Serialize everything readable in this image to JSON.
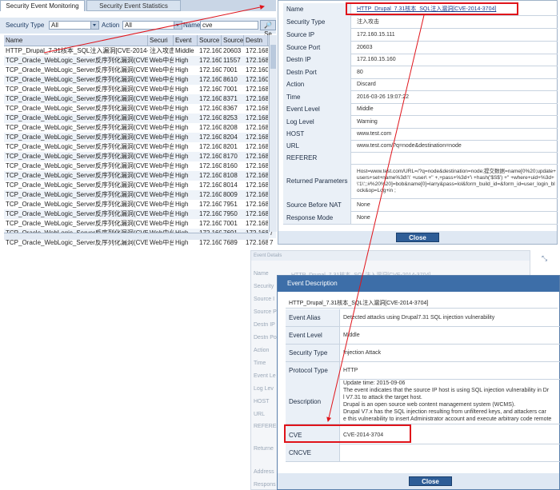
{
  "tabs": [
    {
      "label": "Security Event Monitoring"
    },
    {
      "label": "Security Event Statistics"
    }
  ],
  "filters": {
    "security_type_label": "Security Type",
    "security_type_value": "All",
    "action_label": "Action",
    "action_value": "All",
    "name_label": "Name",
    "name_value": "cve",
    "search_button": "🔎 Se"
  },
  "grid": {
    "headers": [
      "Name",
      "Securi",
      "Event",
      "Source",
      "Source",
      "Destn",
      "D"
    ],
    "rows": [
      [
        "HTTP_Drupal_7.31核本_SQL注入漏洞[CVE-2014-3704]",
        "注入攻击",
        "Middle",
        "172.160",
        "20603",
        "172.168",
        "8"
      ],
      [
        "TCP_Oracle_WebLogic_Server反序列化漏洞(CVE-2015",
        "Web中台",
        "High",
        "172.160",
        "11557",
        "172.168",
        "7"
      ],
      [
        "TCP_Oracle_WebLogic_Server反序列化漏洞(CVE-2015",
        "Web中台",
        "High",
        "172.160",
        "7001",
        "172.160",
        "7"
      ],
      [
        "TCP_Oracle_WebLogic_Server反序列化漏洞(CVE-2015",
        "Web中台",
        "High",
        "172.160",
        "8610",
        "172.160",
        "7"
      ],
      [
        "TCP_Oracle_WebLogic_Server反序列化漏洞(CVE-2015",
        "Web中台",
        "High",
        "172.160",
        "7001",
        "172.168",
        "7"
      ],
      [
        "TCP_Oracle_WebLogic_Server反序列化漏洞(CVE-2015",
        "Web中台",
        "High",
        "172.160",
        "8371",
        "172.168",
        "7"
      ],
      [
        "TCP_Oracle_WebLogic_Server反序列化漏洞(CVE-2015",
        "Web中台",
        "High",
        "172.160",
        "8367",
        "172.168",
        "7"
      ],
      [
        "TCP_Oracle_WebLogic_Server反序列化漏洞(CVE-2015",
        "Web中台",
        "High",
        "172.160",
        "8253",
        "172.168",
        "7"
      ],
      [
        "TCP_Oracle_WebLogic_Server反序列化漏洞(CVE-2015",
        "Web中台",
        "High",
        "172.160",
        "8208",
        "172.168",
        "7"
      ],
      [
        "TCP_Oracle_WebLogic_Server反序列化漏洞(CVE-2015",
        "Web中台",
        "High",
        "172.160",
        "8204",
        "172.168",
        "7"
      ],
      [
        "TCP_Oracle_WebLogic_Server反序列化漏洞(CVE-2015",
        "Web中台",
        "High",
        "172.160",
        "8201",
        "172.168",
        "7"
      ],
      [
        "TCP_Oracle_WebLogic_Server反序列化漏洞(CVE-2015",
        "Web中台",
        "High",
        "172.160",
        "8170",
        "172.168",
        "7"
      ],
      [
        "TCP_Oracle_WebLogic_Server反序列化漏洞(CVE-2015",
        "Web中台",
        "High",
        "172.160",
        "8160",
        "172.168",
        "7"
      ],
      [
        "TCP_Oracle_WebLogic_Server反序列化漏洞(CVE-2015",
        "Web中台",
        "High",
        "172.160",
        "8108",
        "172.168",
        "7"
      ],
      [
        "TCP_Oracle_WebLogic_Server反序列化漏洞(CVE-2015",
        "Web中台",
        "High",
        "172.160",
        "8014",
        "172.168",
        "7"
      ],
      [
        "TCP_Oracle_WebLogic_Server反序列化漏洞(CVE-2015",
        "Web中台",
        "High",
        "172.160",
        "8009",
        "172.168",
        "7"
      ],
      [
        "TCP_Oracle_WebLogic_Server反序列化漏洞(CVE-2015",
        "Web中台",
        "High",
        "172.160",
        "7951",
        "172.168",
        "7"
      ],
      [
        "TCP_Oracle_WebLogic_Server反序列化漏洞(CVE-2015",
        "Web中台",
        "High",
        "172.160",
        "7950",
        "172.168",
        "7"
      ],
      [
        "TCP_Oracle_WebLogic_Server反序列化漏洞(CVE-2015",
        "Web中台",
        "High",
        "172.160",
        "7001",
        "172.168",
        "7"
      ],
      [
        "TCP_Oracle_WebLogic_Server反序列化漏洞(CVE-2015",
        "Web中台",
        "High",
        "172.160",
        "7691",
        "172.168",
        "7"
      ],
      [
        "TCP_Oracle_WebLogic_Server反序列化漏洞(CVE-2015",
        "Web中台",
        "High",
        "172.160",
        "7689",
        "172.168",
        "7"
      ]
    ]
  },
  "details": {
    "rows": [
      {
        "key": "Name",
        "value": "HTTP_Drupal_7.31核本_SQL注入漏洞[CVE-2014-3704]"
      },
      {
        "key": "Security Type",
        "value": "注入攻击"
      },
      {
        "key": "Source IP",
        "value": "172.160.15.111"
      },
      {
        "key": "Source Port",
        "value": "20603"
      },
      {
        "key": "Destn IP",
        "value": "172.160.15.160"
      },
      {
        "key": "Destn Port",
        "value": "80"
      },
      {
        "key": "Action",
        "value": "Discard"
      },
      {
        "key": "Time",
        "value": "2016-03-26 19:07:22"
      },
      {
        "key": "Event Level",
        "value": "Middle"
      },
      {
        "key": "Log Level",
        "value": "Warning"
      },
      {
        "key": "HOST",
        "value": "www.test.com"
      },
      {
        "key": "URL",
        "value": "www.test.com/?q=node&destination=node"
      },
      {
        "key": "REFERER",
        "value": ""
      },
      {
        "key": "Returned Parameters",
        "value": "Host=www.test.com/URL=/?q=node&destination=node;提交数据=name[0%20;update+users+set+name%3d\\'\\' +user\\ +'' +,+pass+%3d+'\\ +hash('$S$') +'' +where+uid+%3d+\\'1\\';;#%20%20]=bob&name[0]=larry&pass=lol&form_build_id=&form_id=user_login_block&op=Log+in ;"
      },
      {
        "key": "Source Before NAT",
        "value": "None"
      },
      {
        "key": "Response Mode",
        "value": "None"
      }
    ],
    "close_label": "Close"
  },
  "faded": {
    "title": "Event Details",
    "name_value": "HTTP_Drupal_7.31核本_SQL注入漏洞[CVE-2014-3704]",
    "keys": [
      "Name",
      "Security",
      "Source I",
      "Source P",
      "Destn IP",
      "Destn Po",
      "Action",
      "Time",
      "Event Le",
      "Log Lev",
      "HOST",
      "URL",
      "REFERER",
      "Returne",
      "Address",
      "Respons"
    ]
  },
  "description": {
    "header": "Event Description",
    "title": "HTTP_Drupal_7.31核本_SQL注入漏洞[CVE-2014-3704]",
    "rows": [
      {
        "key": "Event Alias",
        "value": "Detected attacks using Drupal7.31 SQL injection vulnerability"
      },
      {
        "key": "Event Level",
        "value": "Middle"
      },
      {
        "key": "Security Type",
        "value": "Injection Attack"
      },
      {
        "key": "Protocol Type",
        "value": "HTTP"
      }
    ],
    "desc_key": "Description",
    "desc_lines": [
      "Update time: 2015-09-06",
      "The event indicates that the source IP host is using SQL injection vulnerability in Dr",
      "l V7.31 to attack the target host.",
      "Drupal is an open source web content management system (WCMS).",
      "Drupal V7.x has the SQL injection resulting from unfiltered keys, and attackers car",
      "e this vulnerability to insert Administrator account and execute arbitrary code remote"
    ],
    "cve_key": "CVE",
    "cve_value": "CVE-2014-3704",
    "cncve_key": "CNCVE",
    "cncve_value": "",
    "close_label": "Close"
  },
  "colors": {
    "highlight": "#e0131a",
    "header": "#3d6ea8",
    "button": "#2e5d97"
  }
}
